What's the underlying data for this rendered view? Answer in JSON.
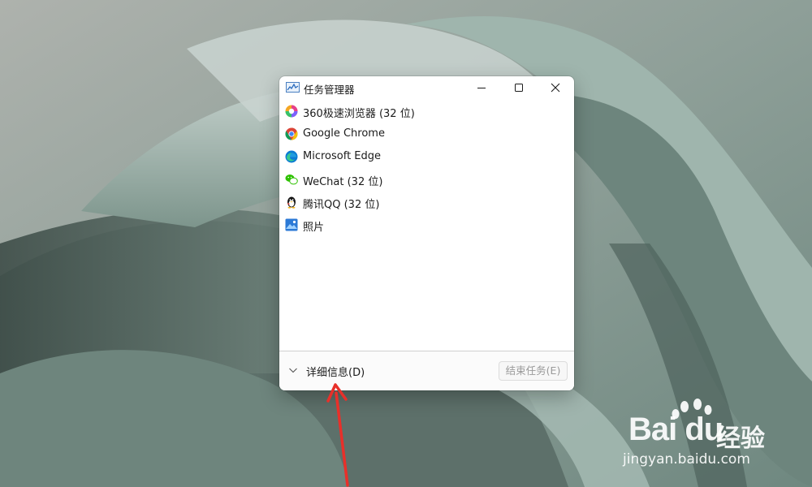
{
  "window": {
    "title": "任务管理器",
    "minimize_label": "Minimize",
    "maximize_label": "Maximize",
    "close_label": "Close"
  },
  "apps": [
    {
      "label": "360极速浏览器 (32 位)",
      "icon": "360-browser-icon"
    },
    {
      "label": "Google Chrome",
      "icon": "chrome-icon"
    },
    {
      "label": "Microsoft Edge",
      "icon": "edge-icon"
    },
    {
      "label": "WeChat (32 位)",
      "icon": "wechat-icon"
    },
    {
      "label": "腾讯QQ (32 位)",
      "icon": "qq-icon"
    },
    {
      "label": "照片",
      "icon": "photos-icon"
    }
  ],
  "footer": {
    "details_label": "详细信息(D)",
    "end_task_label": "结束任务(E)"
  },
  "watermark": {
    "brand": "Bai du",
    "brand_cn": "经验",
    "url": "jingyan.baidu.com"
  },
  "colors": {
    "accent_arrow": "#e8302a",
    "window_bg": "#ffffff",
    "wallpaper": "#8fa39c"
  }
}
